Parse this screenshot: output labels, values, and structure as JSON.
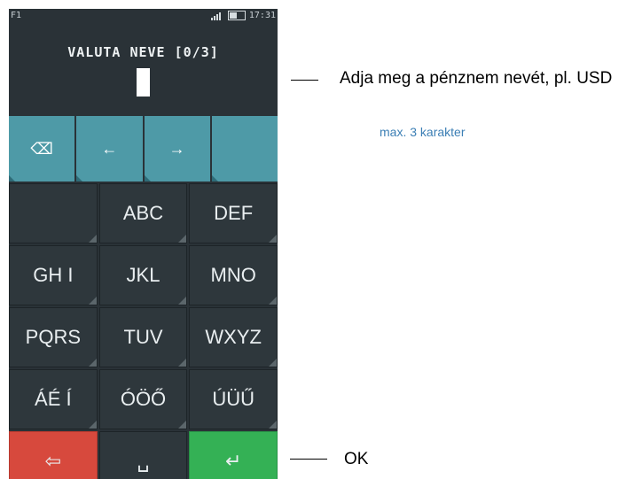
{
  "status": {
    "left_label": "F1",
    "time": "17:31"
  },
  "screen": {
    "title": "VALUTA NEVE [0/3]"
  },
  "teal_keys": [
    "⌫",
    "←",
    "→",
    ""
  ],
  "keys": {
    "row1": [
      "",
      "ABC",
      "DEF"
    ],
    "row2": [
      "GH I",
      "JKL",
      "MNO"
    ],
    "row3": [
      "PQRS",
      "TUV",
      "WXYZ"
    ],
    "row4": [
      "ÁÉ Í",
      "ÓÖŐ",
      "ÚÜŰ"
    ],
    "row5": [
      "⇦",
      "␣",
      "↵"
    ]
  },
  "annotations": {
    "input_desc": "Adja meg a pénznem nevét, pl. USD",
    "input_note": "max. 3 karakter",
    "ok_label": "OK"
  },
  "colors": {
    "teal": "#4e9aa7",
    "red": "#d7493d",
    "green": "#34b155"
  }
}
